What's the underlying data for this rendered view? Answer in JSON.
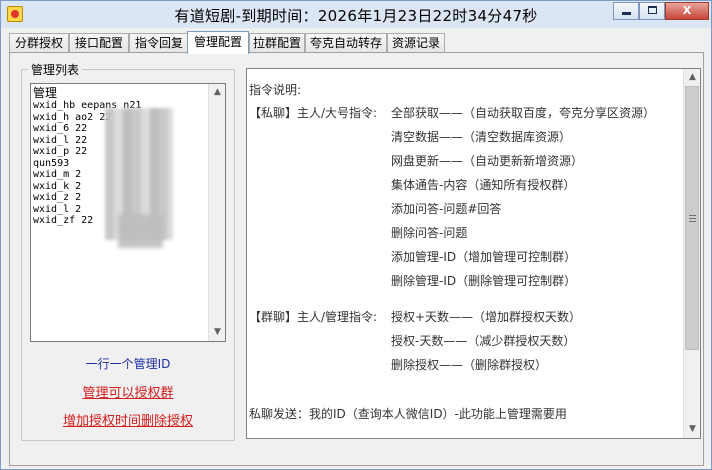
{
  "window": {
    "title": "有道短剧-到期时间：2026年1月23日22时34分47秒",
    "buttons": {
      "close_label": "X"
    }
  },
  "tabs": [
    {
      "label": "分群授权",
      "active": false
    },
    {
      "label": "接口配置",
      "active": false
    },
    {
      "label": "指令回复",
      "active": false
    },
    {
      "label": "管理配置",
      "active": true
    },
    {
      "label": "拉群配置",
      "active": false
    },
    {
      "label": "夸克自动转存",
      "active": false
    },
    {
      "label": "资源记录",
      "active": false
    }
  ],
  "admin_panel": {
    "group_title": "管理列表",
    "list": [
      "管理",
      "wxid_hb   eepans   n21",
      "wxid_h   ao2   22",
      "wxid_6          22",
      "wxid_l          22",
      "wxid_p          22",
      "qun593          ",
      "wxid_m          2",
      "wxid_k          2",
      "wxid_z          2",
      "wxid_l          2",
      "wxid_zf         22"
    ],
    "hint_line": "一行一个管理ID",
    "hint_grant": "管理可以授权群",
    "hint_add_time": "增加授权时间删除授权"
  },
  "instructions": {
    "header": "指令说明:",
    "private_label": "【私聊】主人/大号指令:",
    "private_cmds": [
      "全部获取——（自动获取百度，夸克分享区资源）",
      "清空数据——（清空数据库资源）",
      "网盘更新——（自动更新新增资源）",
      "集体通告-内容（通知所有授权群）",
      "添加问答-问题#回答",
      "删除问答-问题",
      "添加管理-ID（增加管理可控制群）",
      "删除管理-ID（删除管理可控制群）"
    ],
    "group_label": "【群聊】主人/管理指令:",
    "group_cmds": [
      "授权+天数——（增加群授权天数）",
      "授权-天数——（减少群授权天数）",
      "删除授权——（删除群授权）"
    ],
    "footer": "私聊发送：我的ID（查询本人微信ID）-此功能上管理需要用"
  },
  "icons": {
    "app": "app-icon",
    "minimize": "minimize-icon",
    "maximize": "maximize-icon",
    "close": "close-icon",
    "scroll_up": "chevron-up-icon",
    "scroll_down": "chevron-down-icon"
  },
  "colors": {
    "hint_blue": "#1f2ea6",
    "hint_red": "#d41d1d",
    "active_tab_border": "#7f9db9"
  }
}
